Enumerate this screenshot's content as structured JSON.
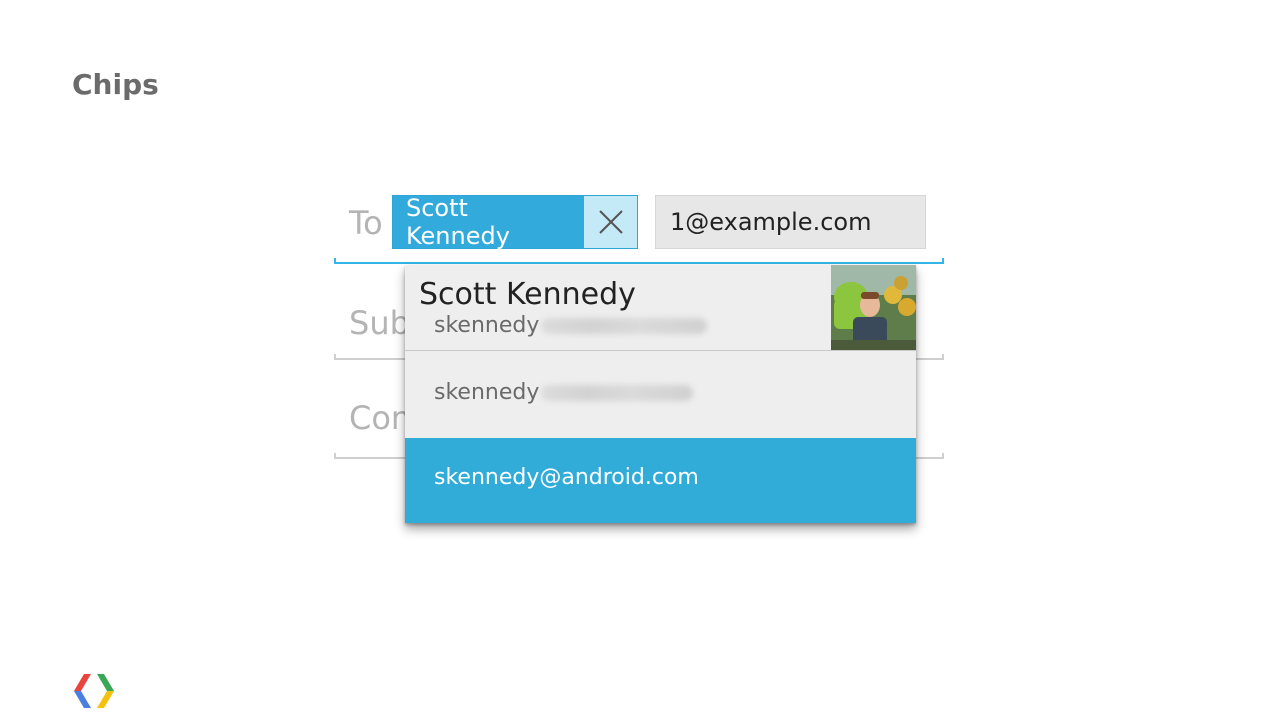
{
  "slide": {
    "title": "Chips"
  },
  "form": {
    "to_label": "To",
    "subject_label": "Subject",
    "compose_label": "Compose"
  },
  "recipient_chip": {
    "name": "Scott Kennedy",
    "close_icon": "close-icon"
  },
  "pending_input": {
    "value": "1@example.com"
  },
  "suggestions": [
    {
      "name": "Scott Kennedy",
      "email_visible": "skennedy",
      "has_avatar": true
    },
    {
      "email_visible": "skennedy"
    },
    {
      "email": "skennedy@android.com",
      "selected": true
    }
  ],
  "colors": {
    "accent": "#33b5e5",
    "chip_bg": "#33aadc",
    "chip_close_bg": "#c4e9f7",
    "selected_row": "#31acd9",
    "logo_red": "#e8453c",
    "logo_blue": "#4a7fe0",
    "logo_green": "#3aa757",
    "logo_yellow": "#f4c20d"
  }
}
